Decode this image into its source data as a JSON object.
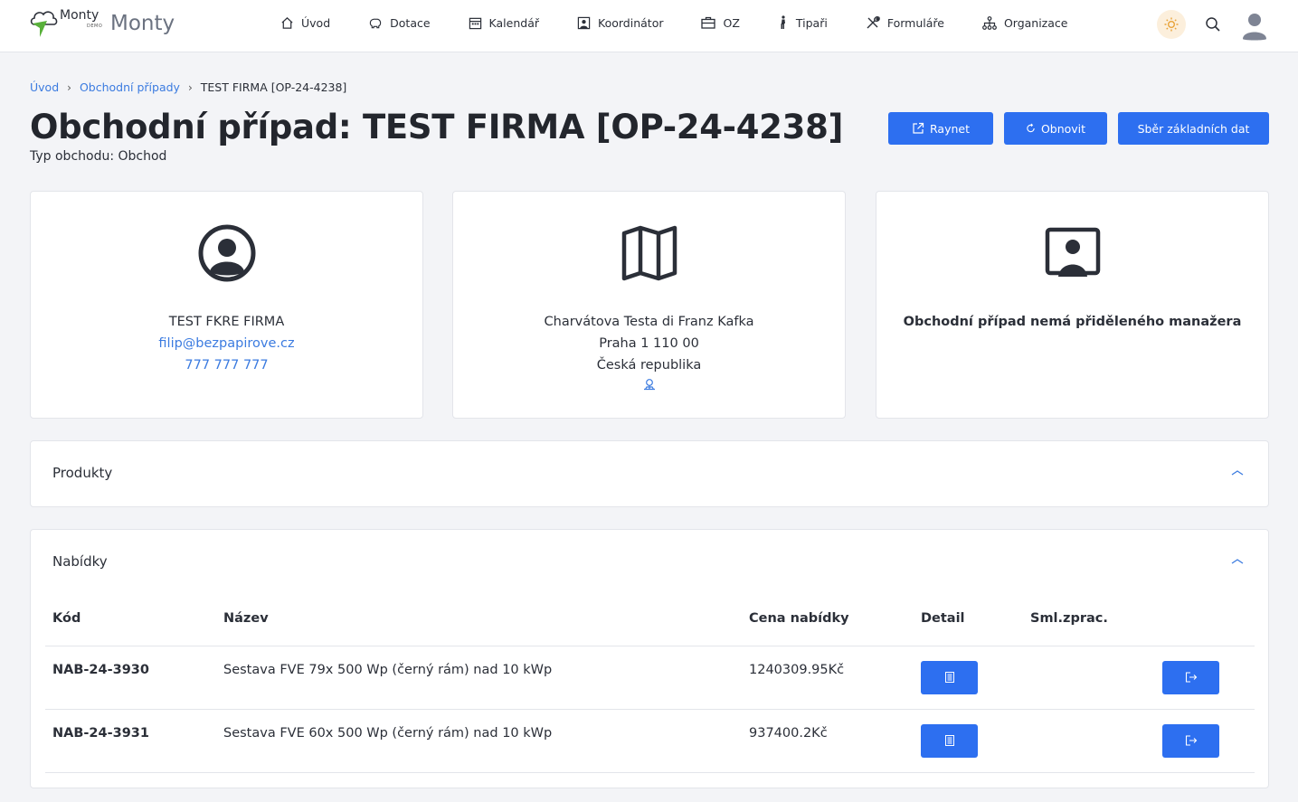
{
  "brand": {
    "logo_small": "Monty",
    "logo_demo": "DEMO",
    "logo_big": "Monty"
  },
  "nav": {
    "items": [
      {
        "label": "Úvod",
        "icon": "home-icon"
      },
      {
        "label": "Dotace",
        "icon": "piggy-bank-icon"
      },
      {
        "label": "Kalendář",
        "icon": "calendar-icon"
      },
      {
        "label": "Koordinátor",
        "icon": "user-square-icon"
      },
      {
        "label": "OZ",
        "icon": "briefcase-icon"
      },
      {
        "label": "Tipaři",
        "icon": "person-walking-icon"
      },
      {
        "label": "Formuláře",
        "icon": "tools-icon"
      },
      {
        "label": "Organizace",
        "icon": "hierarchy-icon"
      }
    ]
  },
  "breadcrumb": {
    "home": "Úvod",
    "parent": "Obchodní případy",
    "current": "TEST FIRMA [OP-24-4238]"
  },
  "page": {
    "title": "Obchodní případ: TEST FIRMA [OP-24-4238]",
    "subtitle": "Typ obchodu: Obchod"
  },
  "actions": {
    "raynet": "Raynet",
    "obnovit": "Obnovit",
    "sber": "Sběr základních dat"
  },
  "cards": {
    "customer": {
      "name": "TEST FKRE FIRMA",
      "email": "filip@bezpapirove.cz",
      "phone": "777 777 777"
    },
    "address": {
      "street": "Charvátova Testa di Franz Kafka",
      "city": "Praha 1 110 00",
      "country": "Česká republika"
    },
    "manager": {
      "text": "Obchodní případ nemá přiděleného manažera"
    }
  },
  "sections": {
    "produkty": {
      "title": "Produkty"
    },
    "nabidky": {
      "title": "Nabídky",
      "columns": [
        "Kód",
        "Název",
        "Cena nabídky",
        "Detail",
        "Sml.zprac.",
        ""
      ],
      "rows": [
        {
          "code": "NAB-24-3930",
          "name": "Sestava FVE 79x 500 Wp (černý rám) nad 10 kWp",
          "price": "1240309.95Kč"
        },
        {
          "code": "NAB-24-3931",
          "name": "Sestava FVE 60x 500 Wp (černý rám) nad 10 kWp",
          "price": "937400.2Kč"
        }
      ]
    }
  },
  "colors": {
    "accent": "#2d6ff0",
    "link": "#3b7be0",
    "logo_green": "#58b03a"
  }
}
